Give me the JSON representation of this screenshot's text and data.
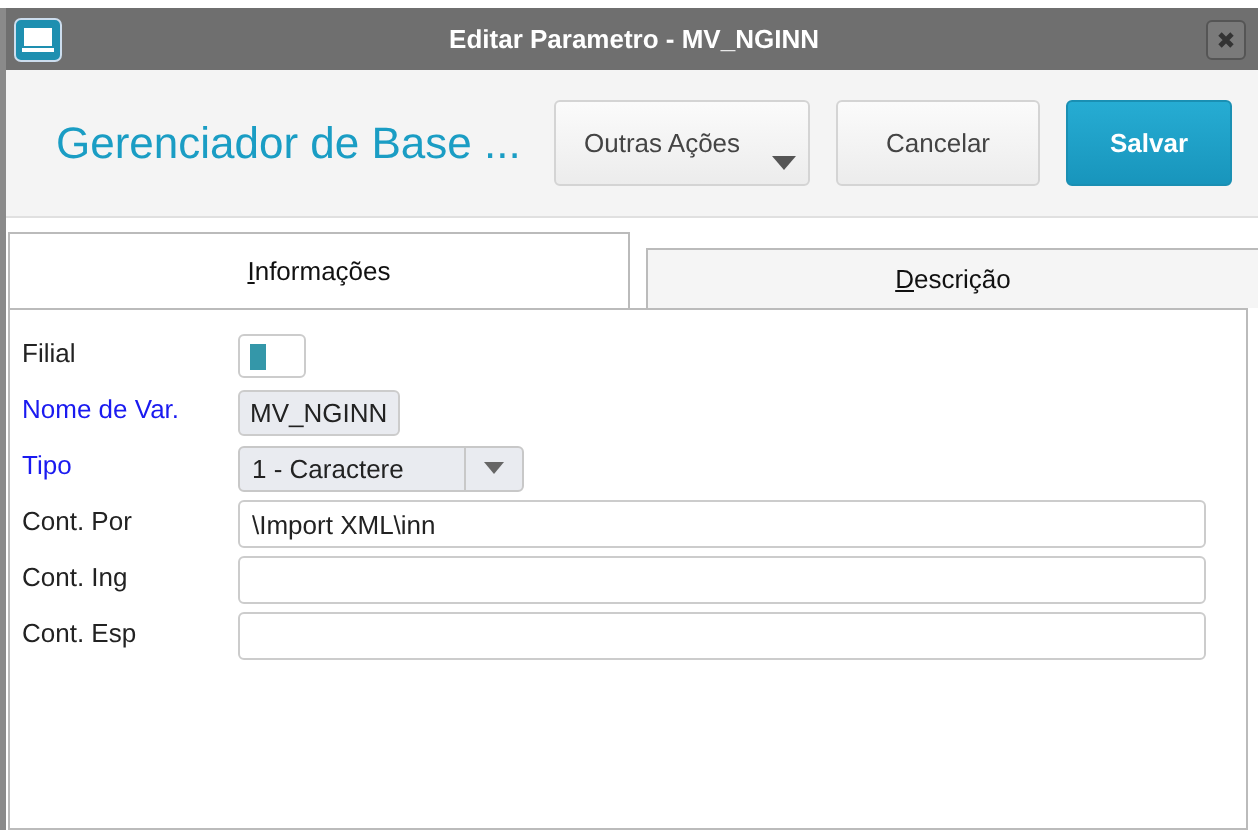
{
  "window": {
    "title": "Editar Parametro - MV_NGINN"
  },
  "header": {
    "title": "Gerenciador de Base ...",
    "buttons": [
      {
        "label": "Outras Ações",
        "kind": "menu"
      },
      {
        "label": "Cancelar",
        "kind": "plain"
      },
      {
        "label": "Salvar",
        "kind": "primary"
      }
    ]
  },
  "tabs": [
    {
      "label": "Informações",
      "selected": true
    },
    {
      "label": "Descrição",
      "selected": false
    }
  ],
  "fields": [
    {
      "label": "Filial",
      "required": false,
      "kind": "branch"
    },
    {
      "label": "Nome de Var.",
      "required": true,
      "kind": "readonly",
      "value": "MV_NGINN"
    },
    {
      "label": "Tipo",
      "required": true,
      "kind": "select",
      "value": "1 - Caractere"
    },
    {
      "label": "Cont. Por",
      "required": false,
      "kind": "text",
      "value": "\\Import XML\\inn"
    },
    {
      "label": "Cont. Ing",
      "required": false,
      "kind": "text"
    },
    {
      "label": "Cont. Esp",
      "required": false,
      "kind": "text"
    }
  ]
}
